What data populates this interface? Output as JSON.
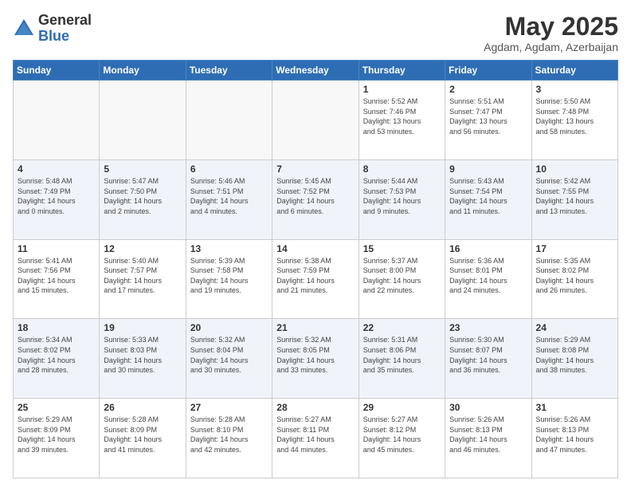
{
  "logo": {
    "general": "General",
    "blue": "Blue"
  },
  "header": {
    "title": "May 2025",
    "subtitle": "Agdam, Agdam, Azerbaijan"
  },
  "days_of_week": [
    "Sunday",
    "Monday",
    "Tuesday",
    "Wednesday",
    "Thursday",
    "Friday",
    "Saturday"
  ],
  "weeks": [
    [
      {
        "day": "",
        "info": ""
      },
      {
        "day": "",
        "info": ""
      },
      {
        "day": "",
        "info": ""
      },
      {
        "day": "",
        "info": ""
      },
      {
        "day": "1",
        "info": "Sunrise: 5:52 AM\nSunset: 7:46 PM\nDaylight: 13 hours\nand 53 minutes."
      },
      {
        "day": "2",
        "info": "Sunrise: 5:51 AM\nSunset: 7:47 PM\nDaylight: 13 hours\nand 56 minutes."
      },
      {
        "day": "3",
        "info": "Sunrise: 5:50 AM\nSunset: 7:48 PM\nDaylight: 13 hours\nand 58 minutes."
      }
    ],
    [
      {
        "day": "4",
        "info": "Sunrise: 5:48 AM\nSunset: 7:49 PM\nDaylight: 14 hours\nand 0 minutes."
      },
      {
        "day": "5",
        "info": "Sunrise: 5:47 AM\nSunset: 7:50 PM\nDaylight: 14 hours\nand 2 minutes."
      },
      {
        "day": "6",
        "info": "Sunrise: 5:46 AM\nSunset: 7:51 PM\nDaylight: 14 hours\nand 4 minutes."
      },
      {
        "day": "7",
        "info": "Sunrise: 5:45 AM\nSunset: 7:52 PM\nDaylight: 14 hours\nand 6 minutes."
      },
      {
        "day": "8",
        "info": "Sunrise: 5:44 AM\nSunset: 7:53 PM\nDaylight: 14 hours\nand 9 minutes."
      },
      {
        "day": "9",
        "info": "Sunrise: 5:43 AM\nSunset: 7:54 PM\nDaylight: 14 hours\nand 11 minutes."
      },
      {
        "day": "10",
        "info": "Sunrise: 5:42 AM\nSunset: 7:55 PM\nDaylight: 14 hours\nand 13 minutes."
      }
    ],
    [
      {
        "day": "11",
        "info": "Sunrise: 5:41 AM\nSunset: 7:56 PM\nDaylight: 14 hours\nand 15 minutes."
      },
      {
        "day": "12",
        "info": "Sunrise: 5:40 AM\nSunset: 7:57 PM\nDaylight: 14 hours\nand 17 minutes."
      },
      {
        "day": "13",
        "info": "Sunrise: 5:39 AM\nSunset: 7:58 PM\nDaylight: 14 hours\nand 19 minutes."
      },
      {
        "day": "14",
        "info": "Sunrise: 5:38 AM\nSunset: 7:59 PM\nDaylight: 14 hours\nand 21 minutes."
      },
      {
        "day": "15",
        "info": "Sunrise: 5:37 AM\nSunset: 8:00 PM\nDaylight: 14 hours\nand 22 minutes."
      },
      {
        "day": "16",
        "info": "Sunrise: 5:36 AM\nSunset: 8:01 PM\nDaylight: 14 hours\nand 24 minutes."
      },
      {
        "day": "17",
        "info": "Sunrise: 5:35 AM\nSunset: 8:02 PM\nDaylight: 14 hours\nand 26 minutes."
      }
    ],
    [
      {
        "day": "18",
        "info": "Sunrise: 5:34 AM\nSunset: 8:02 PM\nDaylight: 14 hours\nand 28 minutes."
      },
      {
        "day": "19",
        "info": "Sunrise: 5:33 AM\nSunset: 8:03 PM\nDaylight: 14 hours\nand 30 minutes."
      },
      {
        "day": "20",
        "info": "Sunrise: 5:32 AM\nSunset: 8:04 PM\nDaylight: 14 hours\nand 30 minutes."
      },
      {
        "day": "21",
        "info": "Sunrise: 5:32 AM\nSunset: 8:05 PM\nDaylight: 14 hours\nand 33 minutes."
      },
      {
        "day": "22",
        "info": "Sunrise: 5:31 AM\nSunset: 8:06 PM\nDaylight: 14 hours\nand 35 minutes."
      },
      {
        "day": "23",
        "info": "Sunrise: 5:30 AM\nSunset: 8:07 PM\nDaylight: 14 hours\nand 36 minutes."
      },
      {
        "day": "24",
        "info": "Sunrise: 5:29 AM\nSunset: 8:08 PM\nDaylight: 14 hours\nand 38 minutes."
      }
    ],
    [
      {
        "day": "25",
        "info": "Sunrise: 5:29 AM\nSunset: 8:09 PM\nDaylight: 14 hours\nand 39 minutes."
      },
      {
        "day": "26",
        "info": "Sunrise: 5:28 AM\nSunset: 8:09 PM\nDaylight: 14 hours\nand 41 minutes."
      },
      {
        "day": "27",
        "info": "Sunrise: 5:28 AM\nSunset: 8:10 PM\nDaylight: 14 hours\nand 42 minutes."
      },
      {
        "day": "28",
        "info": "Sunrise: 5:27 AM\nSunset: 8:11 PM\nDaylight: 14 hours\nand 44 minutes."
      },
      {
        "day": "29",
        "info": "Sunrise: 5:27 AM\nSunset: 8:12 PM\nDaylight: 14 hours\nand 45 minutes."
      },
      {
        "day": "30",
        "info": "Sunrise: 5:26 AM\nSunset: 8:13 PM\nDaylight: 14 hours\nand 46 minutes."
      },
      {
        "day": "31",
        "info": "Sunrise: 5:26 AM\nSunset: 8:13 PM\nDaylight: 14 hours\nand 47 minutes."
      }
    ]
  ]
}
